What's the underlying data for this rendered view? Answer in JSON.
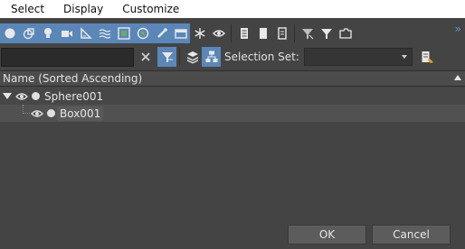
{
  "menu": [
    "Select",
    "Display",
    "Customize"
  ],
  "toolbar": {
    "icons": [
      "geometry-sphere-icon",
      "shapes-icon",
      "lights-icon",
      "cameras-icon",
      "helpers-icon",
      "spacewarps-icon",
      "groups-icon",
      "xrefs-icon",
      "bones-icon",
      "containers-icon",
      "frozen-icon",
      "hidden-icon",
      "select-all-icon",
      "select-none-icon",
      "invert-selection-icon",
      "filter-icon",
      "filter-alt-icon",
      "layers-icon"
    ],
    "more_chevron": "»"
  },
  "filter": {
    "value": "",
    "clear_icon": "×"
  },
  "selection_set": {
    "label": "Selection Set:",
    "value": ""
  },
  "columns": {
    "name_header": "Name (Sorted Ascending)"
  },
  "tree": [
    {
      "label": "Sphere001",
      "level": 0,
      "expanded": true,
      "selected": false
    },
    {
      "label": "Box001",
      "level": 1,
      "expanded": false,
      "selected": true
    }
  ],
  "buttons": {
    "ok": "OK",
    "cancel": "Cancel"
  },
  "colors": {
    "accent": "#5a87b8",
    "background": "#444444",
    "menubar": "#ffffff"
  }
}
